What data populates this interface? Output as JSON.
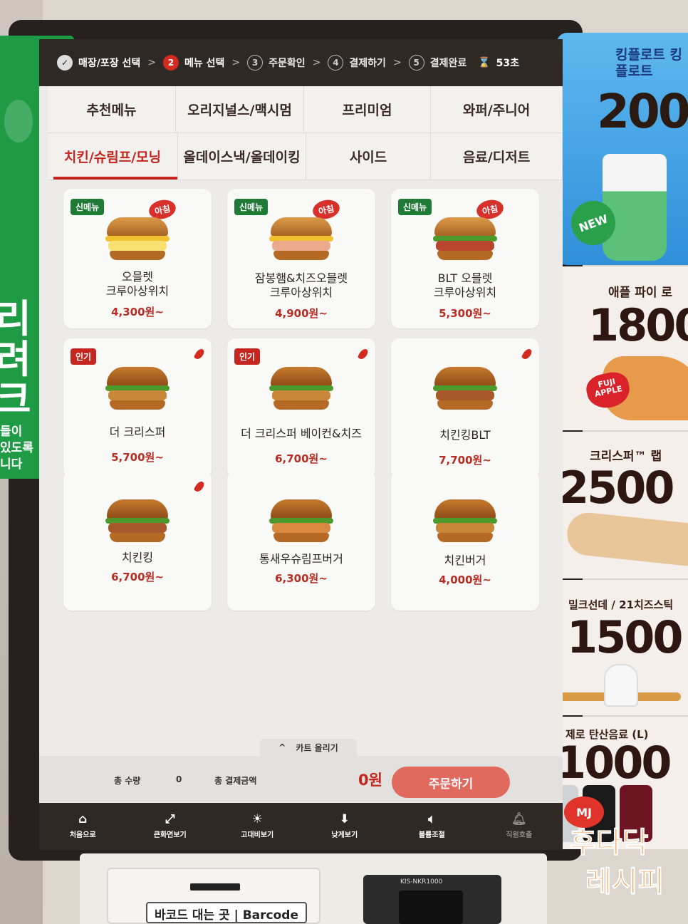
{
  "steps": [
    {
      "num": "✓",
      "label": "매장/포장 선택"
    },
    {
      "num": "2",
      "label": "메뉴 선택"
    },
    {
      "num": "3",
      "label": "주문확인"
    },
    {
      "num": "4",
      "label": "결제하기"
    },
    {
      "num": "5",
      "label": "결제완료"
    }
  ],
  "timer": "53초",
  "categories": [
    {
      "label": "추천메뉴"
    },
    {
      "label": "오리지널스/맥시멈"
    },
    {
      "label": "프리미엄"
    },
    {
      "label": "와퍼/주니어"
    },
    {
      "label": "치킨/슈림프/모닝"
    },
    {
      "label": "올데이스낵/올데이킹"
    },
    {
      "label": "사이드"
    },
    {
      "label": "음료/디저트"
    }
  ],
  "badges": {
    "new": "신메뉴",
    "hot": "인기",
    "morning": "아침"
  },
  "menu_items": [
    {
      "name_line1": "오믈렛",
      "name_line2": "크루아상위치",
      "price": "4,300원~"
    },
    {
      "name_line1": "잠봉햄&치즈오믈렛",
      "name_line2": "크루아상위치",
      "price": "4,900원~"
    },
    {
      "name_line1": "BLT 오믈렛",
      "name_line2": "크루아상위치",
      "price": "5,300원~"
    },
    {
      "name_line1": "더 크리스퍼",
      "name_line2": "",
      "price": "5,700원~"
    },
    {
      "name_line1": "더 크리스퍼 베이컨&치즈",
      "name_line2": "",
      "price": "6,700원~"
    },
    {
      "name_line1": "치킨킹BLT",
      "name_line2": "",
      "price": "7,700원~"
    },
    {
      "name_line1": "치킨킹",
      "name_line2": "",
      "price": "6,700원~"
    },
    {
      "name_line1": "통새우슈림프버거",
      "name_line2": "",
      "price": "6,300원~"
    },
    {
      "name_line1": "치킨버거",
      "name_line2": "",
      "price": "4,000원~"
    }
  ],
  "cart": {
    "pull_label": "카트 올리기",
    "qty_label": "총 수량",
    "qty_value": "0",
    "amount_label": "총 결제금액",
    "amount_value": "0원",
    "order_button": "주문하기"
  },
  "bottom_nav": [
    {
      "label": "처음으로",
      "icon": "home-icon"
    },
    {
      "label": "큰화면보기",
      "icon": "expand-icon"
    },
    {
      "label": "고대비보기",
      "icon": "contrast-icon"
    },
    {
      "label": "낮게보기",
      "icon": "lower-icon"
    },
    {
      "label": "볼륨조절",
      "icon": "volume-icon"
    },
    {
      "label": "직원호출",
      "icon": "bell-icon"
    }
  ],
  "promos": [
    {
      "title": "킹플로트 킹플로트",
      "price": "200"
    },
    {
      "title": "애플 파이 로",
      "price": "1800"
    },
    {
      "title": "크리스퍼™ 랩",
      "price": "2500"
    },
    {
      "title": "밀크선데 / 21치즈스틱",
      "price": "1500"
    },
    {
      "title": "제로 탄산음료 (L)",
      "price": "1000"
    }
  ],
  "promo_badges": {
    "new": "NEW",
    "fuji": "FUJI APPLE"
  },
  "green_card": {
    "big": "리\n려\n크",
    "small": "들이\n있도록\n니다"
  },
  "hardware": {
    "barcode_label": "바코드 대는 곳 | Barcode",
    "reader_model": "KIS-NKR1000"
  },
  "watermark": {
    "line1": "후다닥",
    "line2": "레시피",
    "mark": "MJ"
  },
  "colors": {
    "accent": "#c5261f",
    "nav_bg": "#2f2926",
    "new_badge": "#1f7a35"
  }
}
